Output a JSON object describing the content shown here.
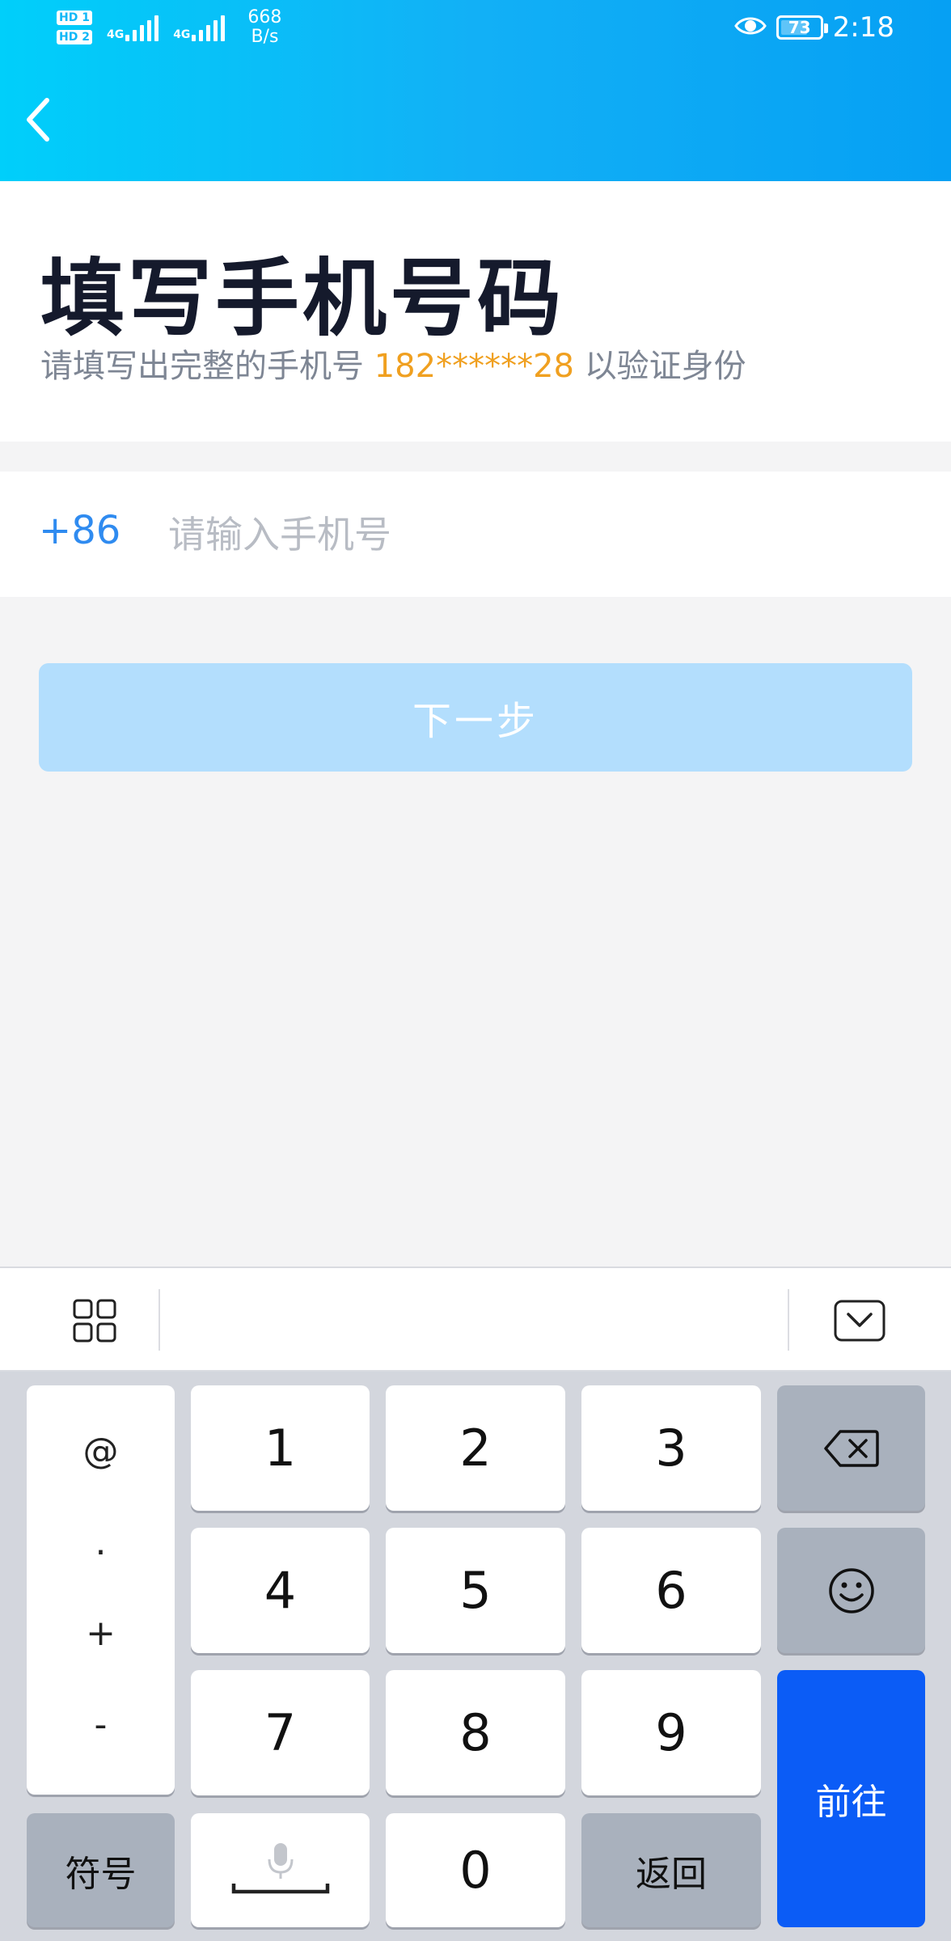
{
  "status_bar": {
    "sim1": "HD 1",
    "sim2": "HD 2",
    "network1": "4G",
    "network2": "4G",
    "speed_value": "668",
    "speed_unit": "B/s",
    "battery": "73",
    "battery_level": 0.73,
    "time": "2:18"
  },
  "header": {
    "back_icon": "chevron-left-icon"
  },
  "title": {
    "heading": "填写手机号码",
    "subtitle_prefix": "请填写出完整的手机号",
    "masked_number": "182******28",
    "subtitle_suffix": "以验证身份"
  },
  "phone": {
    "country_code": "+86",
    "value": "",
    "placeholder": "请输入手机号"
  },
  "next_button": {
    "label": "下一步"
  },
  "keyboard_toolbar": {
    "grid_icon": "grid-icon",
    "hide_icon": "keyboard-hide-icon"
  },
  "keyboard": {
    "symbols": [
      "@",
      ".",
      "+",
      "-"
    ],
    "digits": [
      "1",
      "2",
      "3",
      "4",
      "5",
      "6",
      "7",
      "8",
      "9",
      "0"
    ],
    "symbol_key": "符号",
    "return_key": "返回",
    "go_key": "前往",
    "backspace_icon": "backspace-icon",
    "emoji_icon": "emoji-icon",
    "space_icon": "microphone-space-icon"
  },
  "colors": {
    "accent_blue": "#2f8bf0",
    "masked_orange": "#f0a020",
    "button_disabled": "#b3defd",
    "go_key_blue": "#0b5cf6"
  }
}
